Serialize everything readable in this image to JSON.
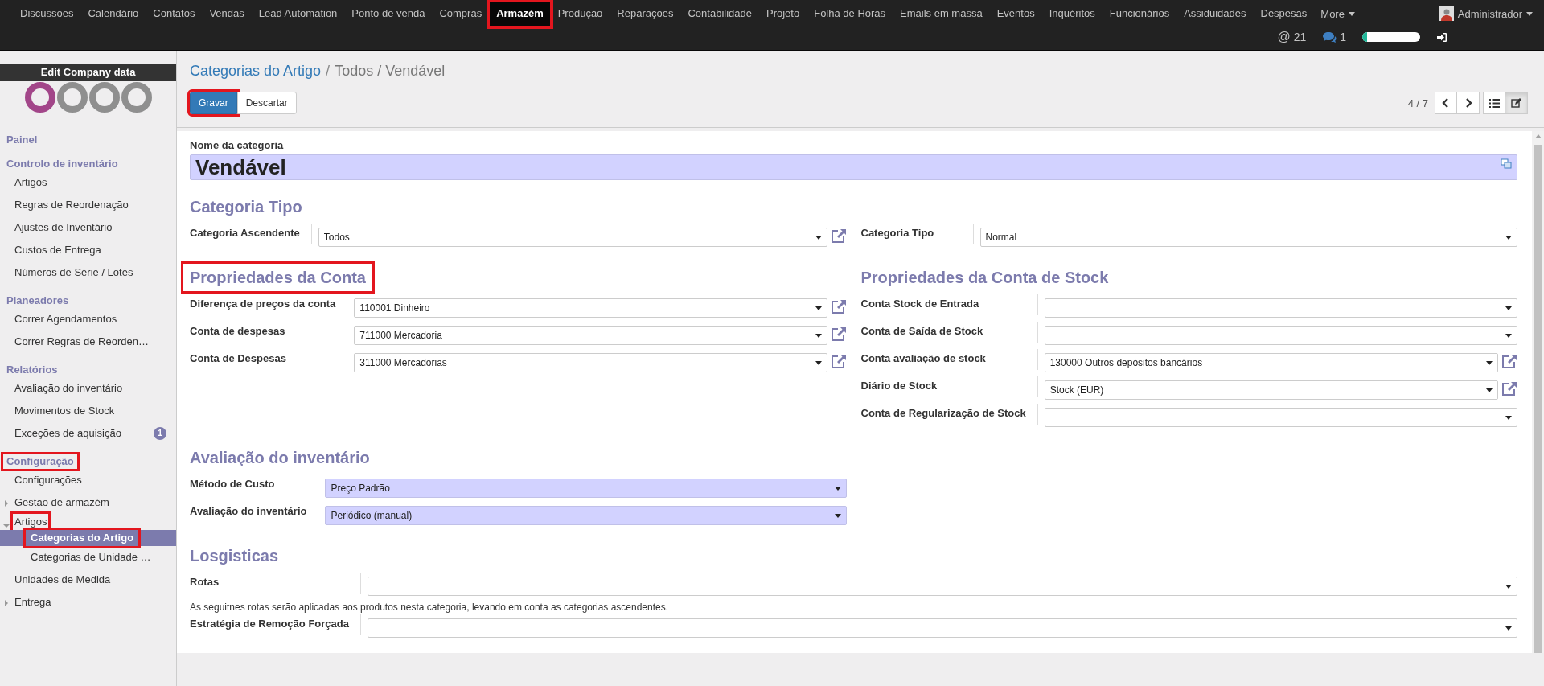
{
  "top_menu": {
    "items": [
      {
        "label": "Discussões",
        "selected": false,
        "highlighted": false
      },
      {
        "label": "Calendário",
        "selected": false,
        "highlighted": false
      },
      {
        "label": "Contatos",
        "selected": false,
        "highlighted": false
      },
      {
        "label": "Vendas",
        "selected": false,
        "highlighted": false
      },
      {
        "label": "Lead Automation",
        "selected": false,
        "highlighted": false
      },
      {
        "label": "Ponto de venda",
        "selected": false,
        "highlighted": false
      },
      {
        "label": "Compras",
        "selected": false,
        "highlighted": false
      },
      {
        "label": "Armazém",
        "selected": true,
        "highlighted": true
      },
      {
        "label": "Produção",
        "selected": false,
        "highlighted": false
      },
      {
        "label": "Reparações",
        "selected": false,
        "highlighted": false
      },
      {
        "label": "Contabilidade",
        "selected": false,
        "highlighted": false
      },
      {
        "label": "Projeto",
        "selected": false,
        "highlighted": false
      },
      {
        "label": "Folha de Horas",
        "selected": false,
        "highlighted": false
      },
      {
        "label": "Emails em massa",
        "selected": false,
        "highlighted": false
      },
      {
        "label": "Eventos",
        "selected": false,
        "highlighted": false
      },
      {
        "label": "Inquéritos",
        "selected": false,
        "highlighted": false
      },
      {
        "label": "Funcionários",
        "selected": false,
        "highlighted": false
      },
      {
        "label": "Assiduidades",
        "selected": false,
        "highlighted": false
      },
      {
        "label": "Despesas",
        "selected": false,
        "highlighted": false
      }
    ],
    "more": "More",
    "user": "Administrador"
  },
  "systray": {
    "mention_icon": "@",
    "mentions": "21",
    "messages": "1",
    "progress": {
      "level": 0.08
    }
  },
  "sidebar": {
    "company_button": "Edit Company data",
    "sections": [
      {
        "title": "Painel",
        "highlighted": false
      },
      {
        "title": "Controlo de inventário",
        "highlighted": false,
        "items": [
          {
            "label": "Artigos",
            "selected": false,
            "highlighted": false
          },
          {
            "label": "Regras de Reordenação",
            "selected": false,
            "highlighted": false
          },
          {
            "label": "Ajustes de Inventário",
            "selected": false,
            "highlighted": false
          },
          {
            "label": "Custos de Entrega",
            "selected": false,
            "highlighted": false
          },
          {
            "label": "Números de Série / Lotes",
            "selected": false,
            "highlighted": false
          }
        ]
      },
      {
        "title": "Planeadores",
        "highlighted": false,
        "items": [
          {
            "label": "Correr Agendamentos",
            "selected": false,
            "highlighted": false
          },
          {
            "label": "Correr Regras de Reorden…",
            "selected": false,
            "highlighted": false
          }
        ]
      },
      {
        "title": "Relatórios",
        "highlighted": false,
        "items": [
          {
            "label": "Avaliação do inventário",
            "selected": false,
            "highlighted": false
          },
          {
            "label": "Movimentos de Stock",
            "selected": false,
            "highlighted": false
          },
          {
            "label": "Exceções de aquisição",
            "selected": false,
            "highlighted": false,
            "badge": "1"
          }
        ]
      },
      {
        "title": "Configuração",
        "highlighted": true,
        "items": [
          {
            "label": "Configurações",
            "selected": false,
            "highlighted": false
          },
          {
            "label": "Gestão de armazém",
            "selected": false,
            "highlighted": false,
            "expanded": false
          },
          {
            "label": "Artigos",
            "selected": false,
            "highlighted": true,
            "expanded": true,
            "children": [
              {
                "label": "Categorias do Artigo",
                "selected": true,
                "highlighted": true
              },
              {
                "label": "Categorias de Unidade …",
                "selected": false,
                "highlighted": false
              }
            ]
          },
          {
            "label": "Unidades de Medida",
            "selected": false,
            "highlighted": false
          },
          {
            "label": "Entrega",
            "selected": false,
            "highlighted": false,
            "expanded": false
          }
        ]
      }
    ]
  },
  "control_panel": {
    "breadcrumb": {
      "link": "Categorias do Artigo",
      "separator": "/",
      "current": "Todos / Vendável"
    },
    "buttons": [
      {
        "label": "Gravar",
        "kind": "primary",
        "highlighted": true
      },
      {
        "label": "Descartar",
        "kind": "secondary",
        "highlighted": false
      }
    ],
    "pager": "4 / 7",
    "views": [
      {
        "kind": "list",
        "selected": false
      },
      {
        "kind": "form",
        "selected": true
      }
    ]
  },
  "form": {
    "name_label": "Nome da categoria",
    "name": "Vendável",
    "sections": [
      {
        "title": "Categoria Tipo",
        "highlighted": false,
        "kind": "two_column",
        "columns": [
          {
            "fields": [
              {
                "label": "Categoria Ascendente",
                "value": "Todos",
                "required": false,
                "link": true
              }
            ]
          },
          {
            "fields": [
              {
                "label": "Categoria Tipo",
                "value": "Normal",
                "required": false,
                "link": false
              }
            ]
          }
        ]
      },
      {
        "kind": "two_column",
        "columns": [
          {
            "title": "Propriedades da Conta",
            "highlighted": true,
            "fields": [
              {
                "label": "Diferença de preços da conta",
                "value": "110001 Dinheiro",
                "required": false,
                "link": true
              },
              {
                "label": "Conta de despesas",
                "value": "711000 Mercadoria",
                "required": false,
                "link": true
              },
              {
                "label": "Conta de Despesas",
                "value": "311000 Mercadorias",
                "required": false,
                "link": true
              }
            ]
          },
          {
            "title": "Propriedades da Conta de Stock",
            "highlighted": false,
            "fields": [
              {
                "label": "Conta Stock de Entrada",
                "required": false,
                "link": false
              },
              {
                "label": "Conta de Saída de Stock",
                "required": false,
                "link": false
              },
              {
                "label": "Conta avaliação de stock",
                "value": "130000 Outros depósitos bancários",
                "required": false,
                "link": true
              },
              {
                "label": "Diário de Stock",
                "value": "Stock (EUR)",
                "required": false,
                "link": true
              },
              {
                "label": "Conta de Regularização de Stock",
                "required": false,
                "link": false
              }
            ]
          }
        ]
      },
      {
        "kind": "two_column",
        "columns": [
          {
            "title": "Avaliação do inventário",
            "highlighted": false,
            "fields": [
              {
                "label": "Método de Custo",
                "value": "Preço Padrão",
                "required": true,
                "link": false
              },
              {
                "label": "Avaliação do inventário",
                "value": "Periódico (manual)",
                "required": true,
                "link": false
              }
            ]
          }
        ]
      },
      {
        "title": "Losgisticas",
        "highlighted": false,
        "kind": "full",
        "columns": [
          {
            "fields": [
              {
                "label": "Rotas",
                "required": false,
                "link": false,
                "help": "As seguitnes rotas serão aplicadas aos produtos nesta categoria, levando em conta as categorias ascendentes."
              },
              {
                "label": "Estratégia de Remoção Forçada",
                "required": false,
                "link": false
              }
            ]
          }
        ]
      }
    ]
  }
}
